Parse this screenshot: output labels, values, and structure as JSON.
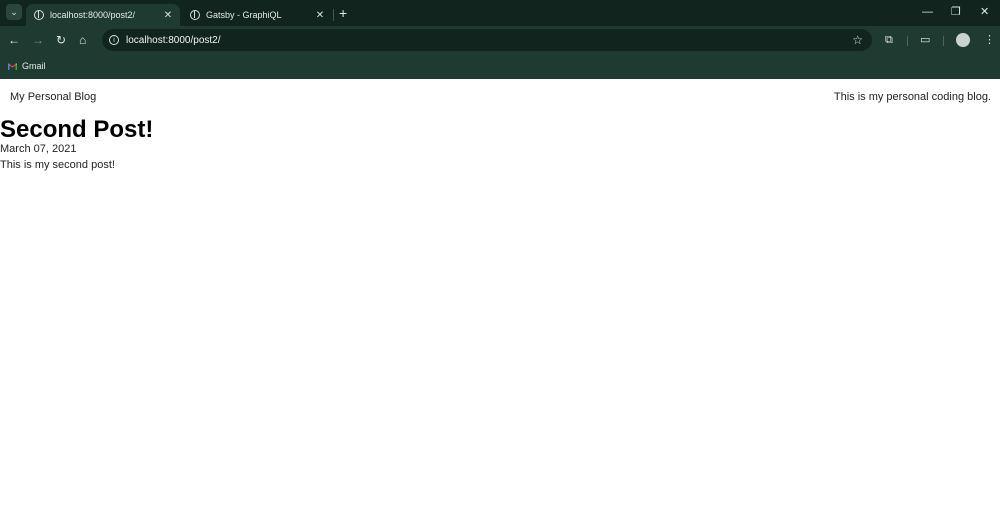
{
  "browser": {
    "tabs": [
      {
        "title": "localhost:8000/post2/",
        "active": true
      },
      {
        "title": "Gatsby - GraphiQL",
        "active": false
      }
    ],
    "address": "localhost:8000/post2/",
    "bookmarks": [
      {
        "label": "Gmail",
        "icon": "gmail-icon"
      }
    ],
    "colors": {
      "frame": "#11241d",
      "toolbar": "#1f3a30"
    }
  },
  "site": {
    "title": "My Personal Blog",
    "description": "This is my personal coding blog."
  },
  "post": {
    "title": "Second Post!",
    "date": "March 07, 2021",
    "body": "This is my second post!"
  }
}
